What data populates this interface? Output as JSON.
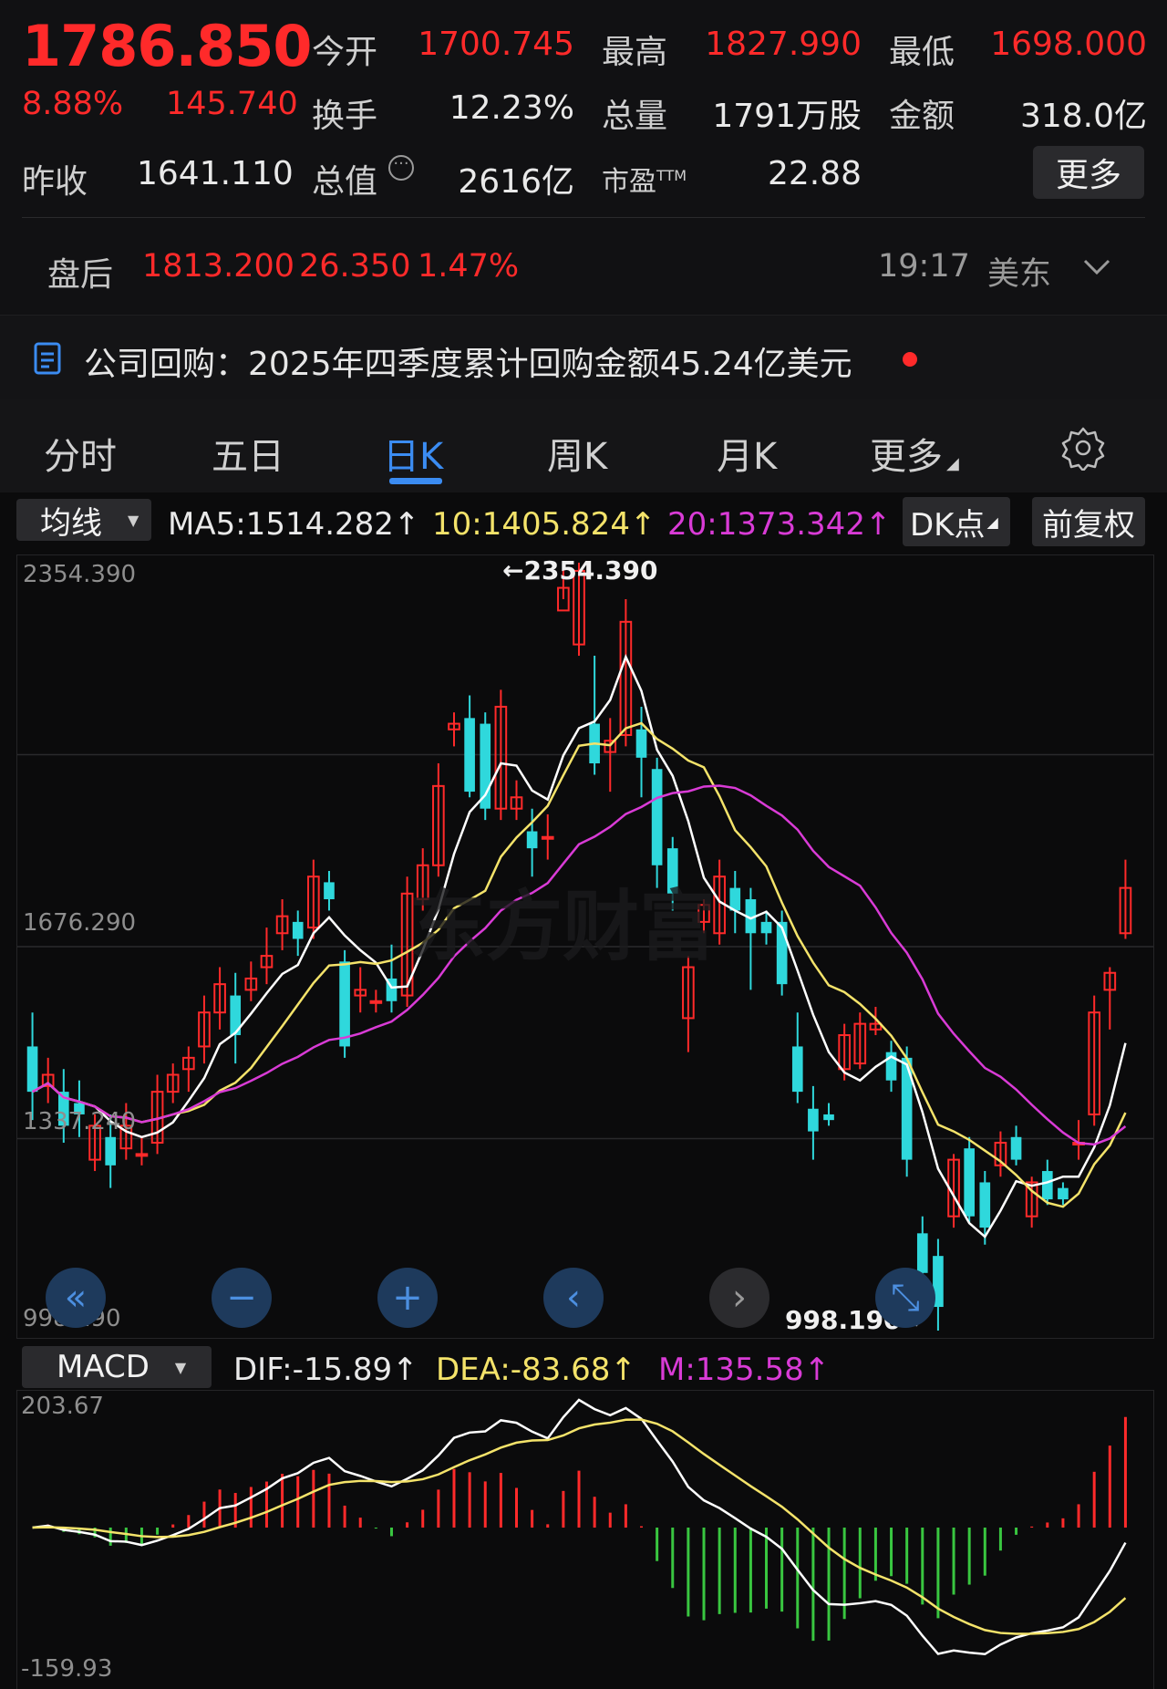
{
  "quote": {
    "price": "1786.850",
    "change_pct": "8.88%",
    "change_amt": "145.740",
    "prev_close_label": "昨收",
    "prev_close": "1641.110",
    "open_label": "今开",
    "open": "1700.745",
    "high_label": "最高",
    "high": "1827.990",
    "low_label": "最低",
    "low": "1698.000",
    "turnover_label": "换手",
    "turnover": "12.23%",
    "volume_label": "总量",
    "volume": "1791万股",
    "amount_label": "金额",
    "amount": "318.0亿",
    "mktcap_label": "总值",
    "mktcap": "2616亿",
    "pe_label": "市盈",
    "pe_sup": "TTM",
    "pe": "22.88",
    "more": "更多"
  },
  "after_hours": {
    "label": "盘后",
    "price": "1813.200",
    "change": "26.350",
    "pct": "1.47%",
    "time": "19:17",
    "zone": "美东"
  },
  "notice": {
    "text": "公司回购：2025年四季度累计回购金额45.24亿美元"
  },
  "tabs": [
    "分时",
    "五日",
    "日K",
    "周K",
    "月K",
    "更多"
  ],
  "ma_bar": {
    "selector": "均线",
    "ma5": "MA5:1514.282↑",
    "ma10": "10:1405.824↑",
    "ma20": "20:1373.342↑",
    "dk": "DK点",
    "adjust": "前复权"
  },
  "kchart_axis": {
    "top": "2354.390",
    "mid": "1676.290",
    "low": "1337.240",
    "bottom": "998.190",
    "max_marker": "←2354.390",
    "min_marker": "998.190→",
    "watermark": "东方财富"
  },
  "macd_bar": {
    "selector": "MACD",
    "dif": "DIF:-15.89↑",
    "dea": "DEA:-83.68↑",
    "m": "M:135.58↑"
  },
  "macd_axis": {
    "top": "203.67",
    "bottom": "-159.93"
  },
  "colors": {
    "up": "#ff2a2a",
    "down": "#2fd8dc",
    "ma5": "#ffffff",
    "ma10": "#f4e36a",
    "ma20": "#d93bd6",
    "accent": "#3b8cf2"
  },
  "chart_data": [
    {
      "type": "candlestick",
      "title": "",
      "ylim": [
        998.19,
        2354.39
      ],
      "candles": [
        [
          1500,
          1420,
          1560,
          1370
        ],
        [
          1430,
          1450,
          1480,
          1400
        ],
        [
          1420,
          1360,
          1460,
          1330
        ],
        [
          1400,
          1380,
          1440,
          1340
        ],
        [
          1300,
          1360,
          1380,
          1280
        ],
        [
          1340,
          1290,
          1380,
          1250
        ],
        [
          1320,
          1360,
          1400,
          1300
        ],
        [
          1310,
          1310,
          1340,
          1290
        ],
        [
          1330,
          1420,
          1450,
          1310
        ],
        [
          1420,
          1450,
          1470,
          1400
        ],
        [
          1460,
          1480,
          1500,
          1420
        ],
        [
          1500,
          1560,
          1590,
          1470
        ],
        [
          1560,
          1610,
          1640,
          1530
        ],
        [
          1590,
          1520,
          1630,
          1470
        ],
        [
          1600,
          1620,
          1650,
          1580
        ],
        [
          1640,
          1660,
          1710,
          1610
        ],
        [
          1700,
          1730,
          1760,
          1670
        ],
        [
          1720,
          1690,
          1740,
          1660
        ],
        [
          1710,
          1800,
          1830,
          1690
        ],
        [
          1790,
          1760,
          1810,
          1740
        ],
        [
          1650,
          1500,
          1670,
          1480
        ],
        [
          1590,
          1600,
          1640,
          1560
        ],
        [
          1580,
          1580,
          1600,
          1560
        ],
        [
          1620,
          1580,
          1680,
          1560
        ],
        [
          1590,
          1770,
          1800,
          1570
        ],
        [
          1760,
          1820,
          1850,
          1740
        ],
        [
          1820,
          1960,
          2000,
          1800
        ],
        [
          2060,
          2070,
          2090,
          2030
        ],
        [
          2080,
          1950,
          2120,
          1940
        ],
        [
          2070,
          1920,
          2090,
          1900
        ],
        [
          1920,
          2100,
          2130,
          1900
        ],
        [
          1920,
          1940,
          1970,
          1900
        ],
        [
          1880,
          1850,
          1920,
          1800
        ],
        [
          1870,
          1870,
          1910,
          1830
        ],
        [
          2270,
          2310,
          2350,
          2290
        ],
        [
          2210,
          2340,
          2354.39,
          2190
        ],
        [
          2070,
          2000,
          2190,
          1980
        ],
        [
          2020,
          2040,
          2080,
          1950
        ],
        [
          2050,
          2250,
          2290,
          2030
        ],
        [
          2060,
          2010,
          2100,
          1940
        ],
        [
          1990,
          1820,
          2010,
          1780
        ],
        [
          1850,
          1770,
          1870,
          1740
        ],
        [
          1550,
          1640,
          1660,
          1490
        ],
        [
          1720,
          1750,
          1760,
          1700
        ],
        [
          1700,
          1800,
          1830,
          1680
        ],
        [
          1780,
          1740,
          1810,
          1700
        ],
        [
          1760,
          1700,
          1780,
          1600
        ],
        [
          1720,
          1700,
          1740,
          1680
        ],
        [
          1720,
          1610,
          1740,
          1590
        ],
        [
          1500,
          1420,
          1560,
          1400
        ],
        [
          1390,
          1350,
          1430,
          1300
        ],
        [
          1380,
          1370,
          1400,
          1360
        ],
        [
          1460,
          1520,
          1540,
          1440
        ],
        [
          1470,
          1540,
          1560,
          1460
        ],
        [
          1530,
          1540,
          1570,
          1520
        ],
        [
          1490,
          1440,
          1510,
          1420
        ],
        [
          1480,
          1300,
          1500,
          1270
        ],
        [
          1170,
          1100,
          1200,
          1060
        ],
        [
          1130,
          1040,
          1160,
          998.19
        ],
        [
          1200,
          1300,
          1310,
          1180
        ],
        [
          1320,
          1200,
          1340,
          1190
        ],
        [
          1260,
          1180,
          1280,
          1150
        ],
        [
          1290,
          1330,
          1350,
          1270
        ],
        [
          1340,
          1300,
          1360,
          1290
        ],
        [
          1200,
          1260,
          1270,
          1180
        ],
        [
          1280,
          1230,
          1300,
          1220
        ],
        [
          1250,
          1230,
          1260,
          1220
        ],
        [
          1330,
          1330,
          1370,
          1300
        ],
        [
          1380,
          1560,
          1590,
          1360
        ],
        [
          1600,
          1630,
          1640,
          1530
        ],
        [
          1700,
          1780,
          1830,
          1690
        ]
      ],
      "ma5": "white",
      "ma10": "yellow",
      "ma20": "magenta"
    },
    {
      "type": "macd",
      "ylim": [
        -159.93,
        203.67
      ]
    }
  ]
}
